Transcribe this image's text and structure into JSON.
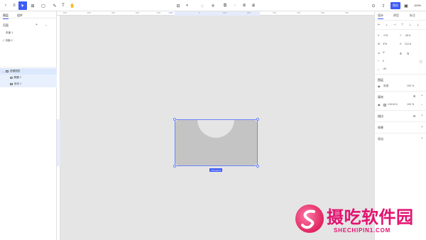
{
  "toolbar": {
    "tools": [
      "back-icon",
      "menu-icon",
      "select-icon",
      "frame-icon",
      "rectangle-icon",
      "pen-icon",
      "text-icon",
      "hand-icon"
    ],
    "save_label": "保存",
    "zoom": "100%"
  },
  "left_panel": {
    "tabs": [
      "图层",
      "组件"
    ],
    "pages_header": "页面",
    "pages": [
      "页面 1",
      "页面 2"
    ],
    "layers": [
      {
        "label": "遮罩图层",
        "type": "frame"
      },
      {
        "label": "椭圆 2",
        "type": "ellipse"
      },
      {
        "label": "矩形 1",
        "type": "rect"
      }
    ]
  },
  "ruler": {
    "ticks": [
      "-600",
      "-500",
      "-400",
      "-300",
      "-200",
      "-176",
      "0",
      "100",
      "200",
      "300",
      "400",
      "500",
      "600"
    ]
  },
  "canvas": {
    "size_label": "376×212.6"
  },
  "right_panel": {
    "tabs": [
      "设计",
      "原型",
      "标注"
    ],
    "x": "-176",
    "y": "-28.6",
    "w": "376",
    "h": "212.6",
    "rotation": "0°",
    "radius": "0",
    "opacity_val": "-90",
    "layer_header": "图层",
    "blend_mode": "穿透",
    "layer_opacity": "100 %",
    "fill_header": "填充",
    "fill_hex": "C4C4C4",
    "fill_opacity": "100 %",
    "stroke_header": "描边",
    "effect_header": "效果",
    "export_header": "导出"
  },
  "watermark": {
    "title": "摄吃软件园",
    "url": "SHECHIPIN1.COM"
  },
  "colors": {
    "accent": "#3e5bf5",
    "shape_fill": "#c4c4c4",
    "canvas_bg": "#e5e5e5",
    "watermark": "#e3126f"
  }
}
